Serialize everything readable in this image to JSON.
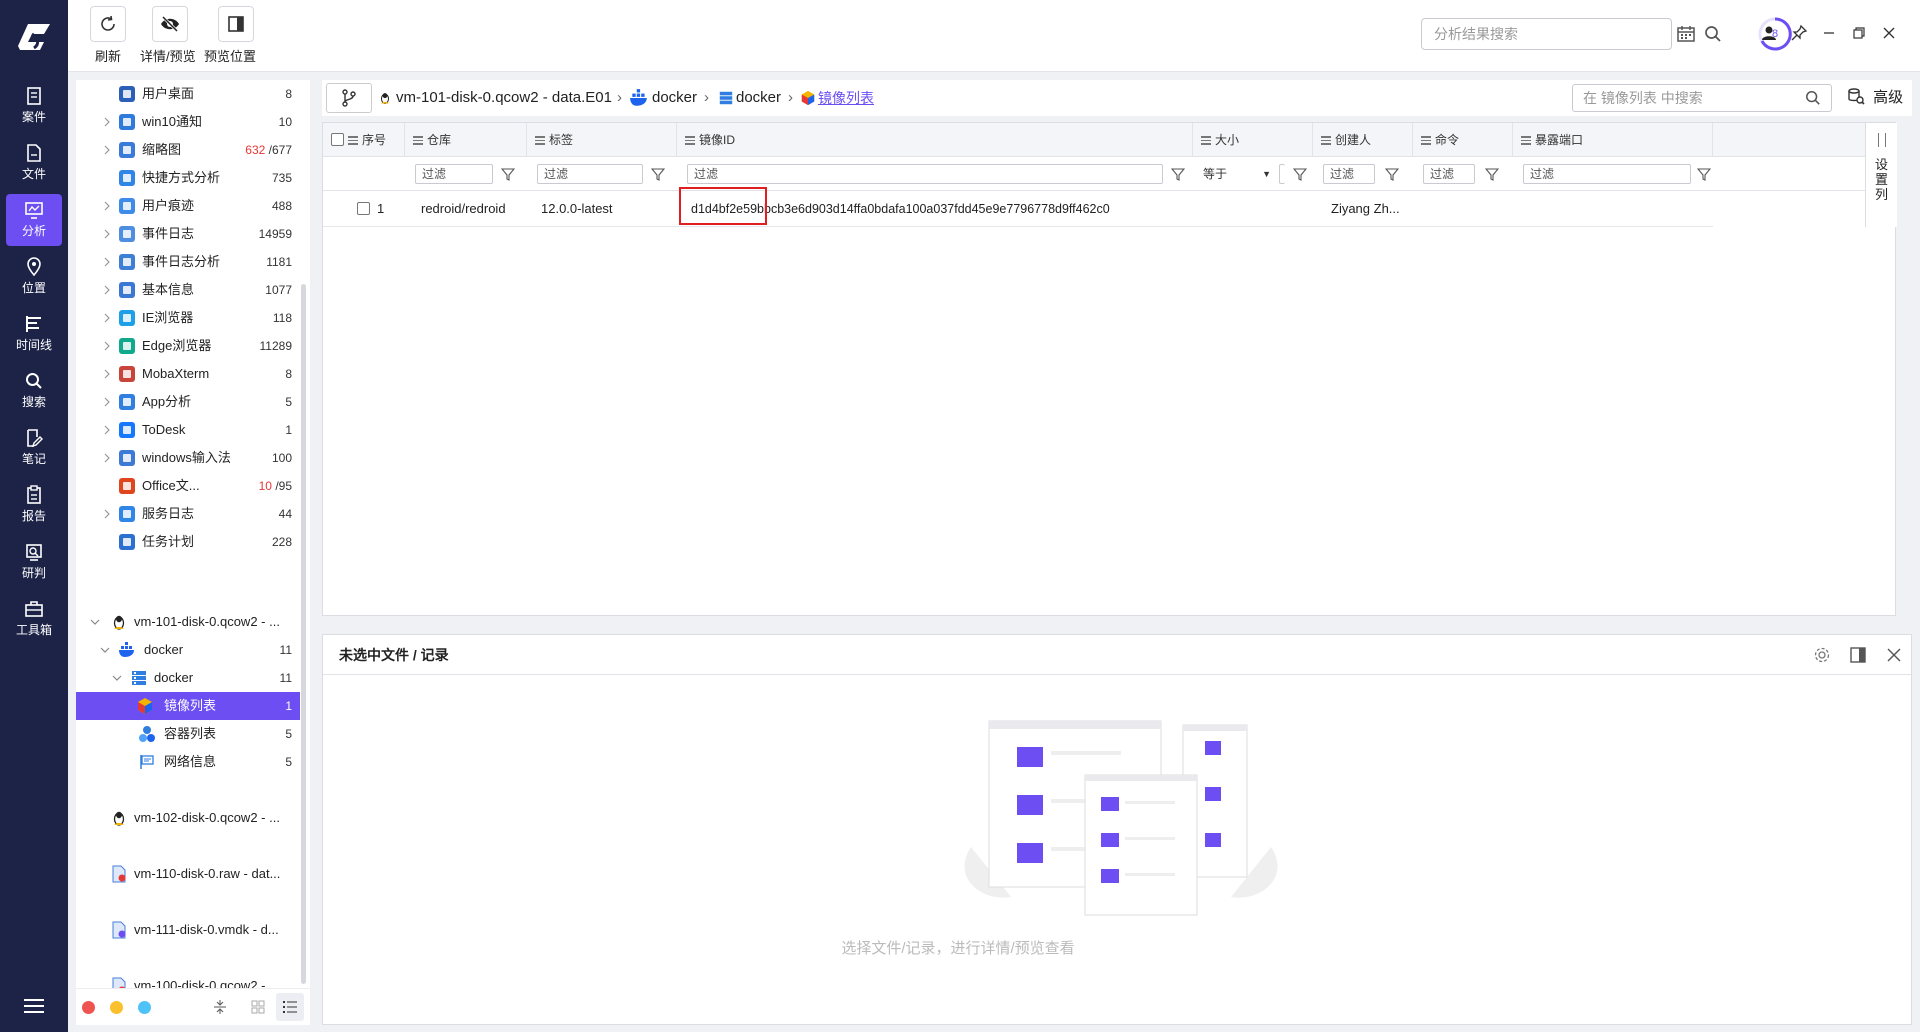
{
  "nav": {
    "items": [
      {
        "id": "case",
        "label": "案件"
      },
      {
        "id": "file",
        "label": "文件"
      },
      {
        "id": "analysis",
        "label": "分析"
      },
      {
        "id": "location",
        "label": "位置"
      },
      {
        "id": "timeline",
        "label": "时间线"
      },
      {
        "id": "search",
        "label": "搜索"
      },
      {
        "id": "notes",
        "label": "笔记"
      },
      {
        "id": "report",
        "label": "报告"
      },
      {
        "id": "research",
        "label": "研判"
      },
      {
        "id": "toolbox",
        "label": "工具箱"
      }
    ],
    "active": "analysis"
  },
  "toolbar": {
    "refresh": "刷新",
    "detail_preview": "详情/预览",
    "preview_position": "预览位置",
    "search_placeholder": "分析结果搜索",
    "task_count": "8"
  },
  "tree": {
    "items": [
      {
        "label": "用户桌面",
        "count": "8",
        "icon_color": "#2b5fb8",
        "icon": "desktop-icon"
      },
      {
        "label": "win10通知",
        "count": "10",
        "icon_color": "#2e7bdc",
        "icon": "bell-icon"
      },
      {
        "label": "缩略图",
        "count_red": "632",
        "count": "/677",
        "icon_color": "#3a7ad8",
        "icon": "thumbnail-icon"
      },
      {
        "label": "快捷方式分析",
        "count": "735",
        "icon_color": "#2f86e6",
        "icon": "shortcut-icon"
      },
      {
        "label": "用户痕迹",
        "count": "488",
        "icon_color": "#3f8be8",
        "icon": "trace-icon"
      },
      {
        "label": "事件日志",
        "count": "14959",
        "icon_color": "#4f8de0",
        "icon": "event-log-icon"
      },
      {
        "label": "事件日志分析",
        "count": "1181",
        "icon_color": "#3e7fd6",
        "icon": "event-analysis-icon"
      },
      {
        "label": "基本信息",
        "count": "1077",
        "icon_color": "#3b78d4",
        "icon": "info-icon"
      },
      {
        "label": "IE浏览器",
        "count": "118",
        "icon_color": "#1ea0e8",
        "icon": "ie-icon"
      },
      {
        "label": "Edge浏览器",
        "count": "11289",
        "icon_color": "#11a98b",
        "icon": "edge-icon"
      },
      {
        "label": "MobaXterm",
        "count": "8",
        "icon_color": "#c7453a",
        "icon": "mobaxterm-icon"
      },
      {
        "label": "App分析",
        "count": "5",
        "icon_color": "#2f7ee0",
        "icon": "app-icon"
      },
      {
        "label": "ToDesk",
        "count": "1",
        "icon_color": "#1677ff",
        "icon": "todesk-icon"
      },
      {
        "label": "windows输入法",
        "count": "100",
        "icon_color": "#3d7ad6",
        "icon": "keyboard-icon"
      },
      {
        "label": "Office文...",
        "count_red": "10",
        "count": "/95",
        "icon_color": "#e0461d",
        "icon": "office-icon"
      },
      {
        "label": "服务日志",
        "count": "44",
        "icon_color": "#2f86e6",
        "icon": "service-icon"
      },
      {
        "label": "任务计划",
        "count": "228",
        "icon_color": "#2b6fd0",
        "icon": "task-icon"
      }
    ],
    "vm101": "vm-101-disk-0.qcow2 - ...",
    "docker_group": {
      "label": "docker",
      "count": "11"
    },
    "docker_sub": {
      "label": "docker",
      "count": "11"
    },
    "image_list": {
      "label": "镜像列表",
      "count": "1"
    },
    "container_list": {
      "label": "容器列表",
      "count": "5"
    },
    "network_info": {
      "label": "网络信息",
      "count": "5"
    },
    "vm102": "vm-102-disk-0.qcow2 - ...",
    "vm110": "vm-110-disk-0.raw - dat...",
    "vm111": "vm-111-disk-0.vmdk - d...",
    "vm100": "vm-100-disk-0.qcow2 - ..."
  },
  "breadcrumb": {
    "root": "vm-101-disk-0.qcow2 - data.E01",
    "docker1": "docker",
    "docker2": "docker",
    "current": "镜像列表",
    "search_placeholder": "在 镜像列表 中搜索",
    "advanced": "高级"
  },
  "table": {
    "columns": {
      "seq": "序号",
      "repo": "仓库",
      "tag": "标签",
      "image_id": "镜像ID",
      "size": "大小",
      "creator": "创建人",
      "command": "命令",
      "exposed_ports": "暴露端口"
    },
    "filter_placeholder": "过滤",
    "size_operator": "等于",
    "rows": [
      {
        "seq": "1",
        "repo": "redroid/redroid",
        "tag": "12.0.0-latest",
        "image_id": "d1d4bf2e59bbcb3e6d903d14ffa0bdafa100a037fdd45e9e7796778d9ff462c0",
        "size": "",
        "creator": "Ziyang Zh...",
        "command": "",
        "ports": ""
      }
    ],
    "side_settings": "设置列"
  },
  "preview": {
    "title": "未选中文件 / 记录",
    "hint": "选择文件/记录，进行详情/预览查看"
  },
  "colors": {
    "nav_bg": "#1c2347",
    "accent": "#6c4ef2",
    "highlight_box": "#e02020"
  }
}
